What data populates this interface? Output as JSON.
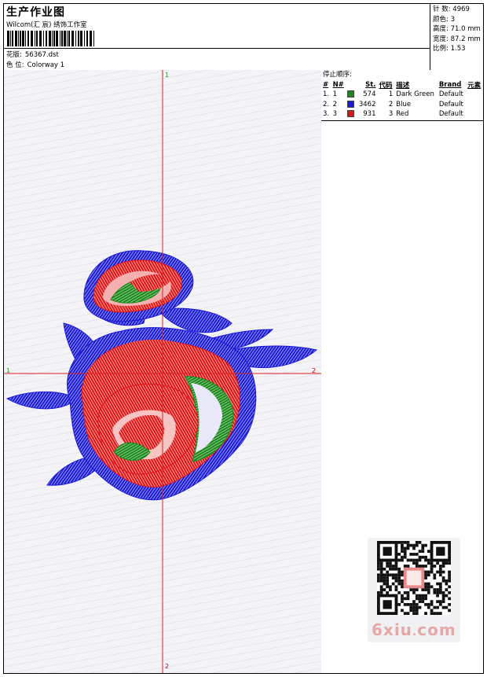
{
  "header": {
    "title": "生产作业图",
    "studio": "Wilcom(汇 宸) 绣饰工作室",
    "file_label": "花版:",
    "file_value": "56367.dst",
    "colorway_label": "色 位:",
    "colorway_value": "Colorway 1"
  },
  "specs": [
    {
      "label": "针 数:",
      "value": "4969"
    },
    {
      "label": "颜色:",
      "value": "3"
    },
    {
      "label": "高度:",
      "value": "71.0 mm"
    },
    {
      "label": "宽度:",
      "value": "87.2 mm"
    },
    {
      "label": "比例:",
      "value": "1.53"
    }
  ],
  "axes": {
    "top": "1",
    "left": "1",
    "right": "2",
    "bottom": "2"
  },
  "stops": {
    "heading": "停止顺序:",
    "columns": [
      "#",
      "N#",
      "St.",
      "代码",
      "描述",
      "Brand",
      "元素"
    ],
    "rows": [
      {
        "index": "1.",
        "n": "1",
        "color": "#1a8a1a",
        "st": "574",
        "code": "1",
        "desc": "Dark Green",
        "brand": "Default"
      },
      {
        "index": "2.",
        "n": "2",
        "color": "#1a1ad8",
        "st": "3462",
        "code": "2",
        "desc": "Blue",
        "brand": "Default"
      },
      {
        "index": "3.",
        "n": "3",
        "color": "#e01414",
        "st": "931",
        "code": "3",
        "desc": "Red",
        "brand": "Default"
      }
    ]
  },
  "watermark": {
    "text": "6xiu",
    "dot": ".",
    "tld": "com"
  },
  "colors": {
    "green": "#1a8a1a",
    "blue": "#1a1ad8",
    "red": "#e01414",
    "axis_red": "#d42020",
    "axis_green": "#1aa31a"
  }
}
